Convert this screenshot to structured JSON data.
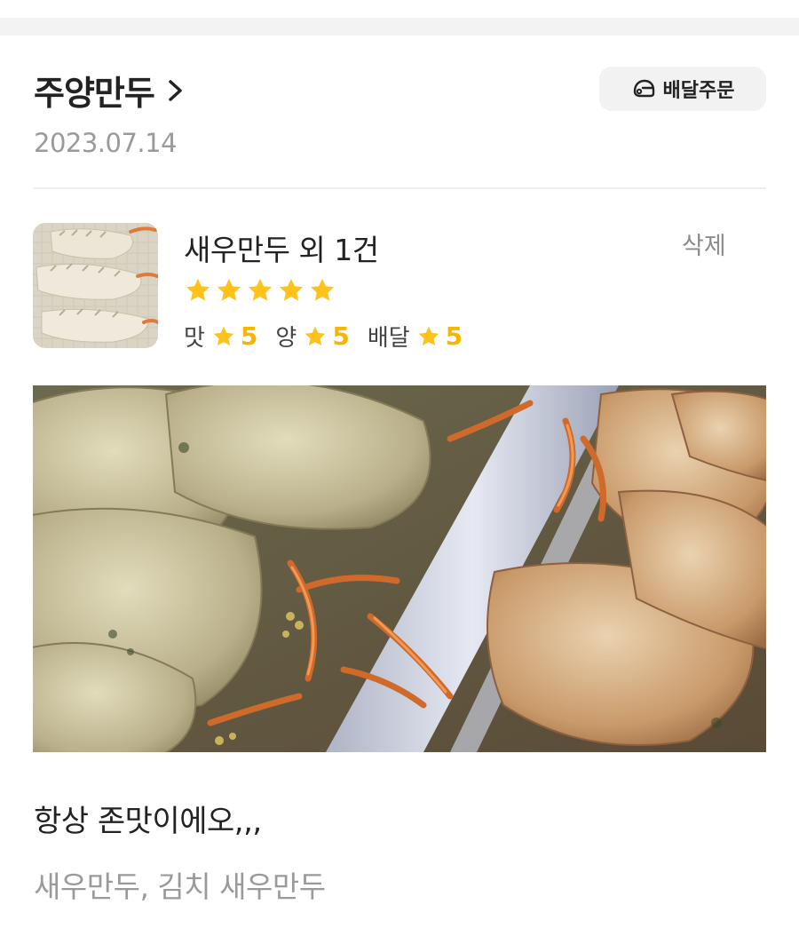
{
  "store": {
    "name": "주양만두"
  },
  "order_button": {
    "label": "배달주문"
  },
  "review": {
    "date": "2023.07.14",
    "menu_title": "새우만두 외 1건",
    "delete_label": "삭제",
    "overall_stars": 5,
    "sub_ratings": [
      {
        "label": "맛",
        "value": "5"
      },
      {
        "label": "양",
        "value": "5"
      },
      {
        "label": "배달",
        "value": "5"
      }
    ],
    "text": "항상 존맛이에오,,,",
    "menus": "새우만두, 김치 새우만두"
  },
  "colors": {
    "star": "#FFC21A",
    "sub_value": "#F7B500",
    "muted_text": "#9A9A9A",
    "button_bg": "#F2F2F2"
  },
  "icons": [
    "chevron-right-icon",
    "delivery-helmet-icon",
    "star-icon"
  ]
}
